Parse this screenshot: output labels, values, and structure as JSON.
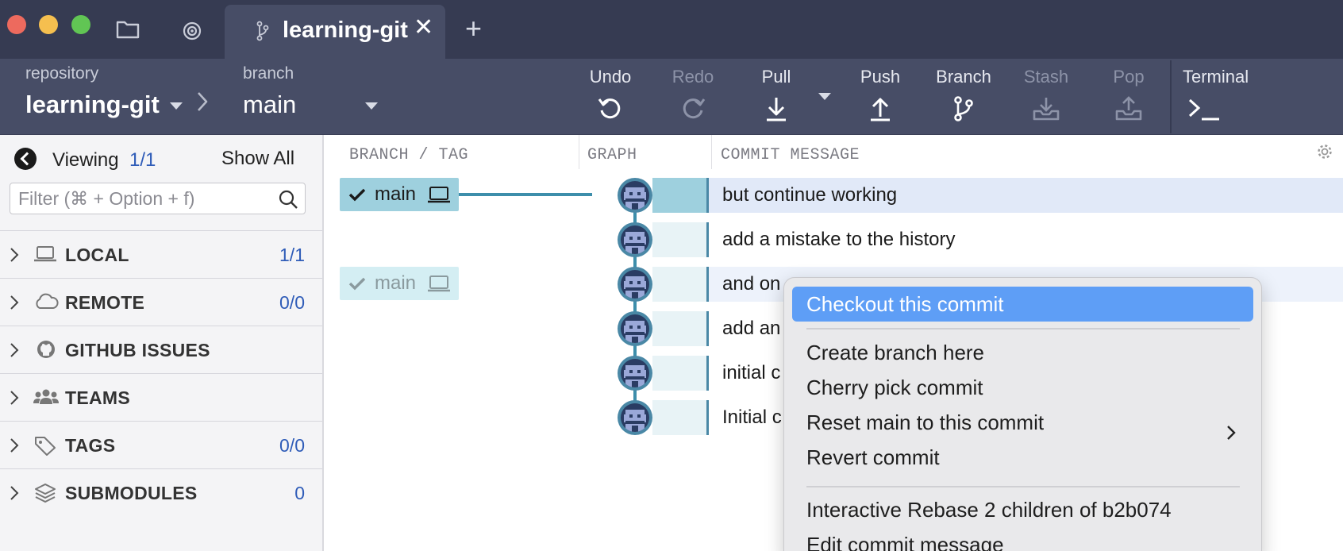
{
  "titlebar": {
    "tab_title": "learning-git",
    "close_glyph": "✕",
    "add_glyph": "+",
    "icons": [
      "folder-icon",
      "radar-icon",
      "branch-icon"
    ]
  },
  "toolbar": {
    "repo_label": "repository",
    "repo_name": "learning-git",
    "branch_label": "branch",
    "branch_name": "main",
    "buttons": {
      "undo": "Undo",
      "redo": "Redo",
      "pull": "Pull",
      "push": "Push",
      "branch": "Branch",
      "stash": "Stash",
      "pop": "Pop",
      "terminal": "Terminal"
    }
  },
  "sidebar": {
    "viewing_label": "Viewing",
    "viewing_count": "1/1",
    "show_all": "Show All",
    "filter_placeholder": "Filter (⌘ + Option + f)",
    "sections": [
      {
        "name": "LOCAL",
        "count": "1/1",
        "icon": "laptop-icon"
      },
      {
        "name": "REMOTE",
        "count": "0/0",
        "icon": "cloud-icon"
      },
      {
        "name": "GITHUB ISSUES",
        "count": "",
        "icon": "github-icon"
      },
      {
        "name": "TEAMS",
        "count": "",
        "icon": "team-icon"
      },
      {
        "name": "TAGS",
        "count": "0/0",
        "icon": "tag-icon"
      },
      {
        "name": "SUBMODULES",
        "count": "0",
        "icon": "layers-icon"
      }
    ]
  },
  "graph": {
    "col_branch": "BRANCH / TAG",
    "col_graph": "GRAPH",
    "col_message": "COMMIT MESSAGE",
    "refs": [
      {
        "name": "main",
        "state": "active"
      },
      {
        "name": "main",
        "state": "faded"
      }
    ],
    "commits": [
      {
        "message": "but continue working",
        "highlighted": true
      },
      {
        "message": "add a mistake to the history",
        "highlighted": false
      },
      {
        "message": "and on",
        "highlighted": true
      },
      {
        "message": "add an",
        "highlighted": false
      },
      {
        "message": "initial c",
        "highlighted": false
      },
      {
        "message": "Initial c",
        "highlighted": false
      }
    ]
  },
  "context_menu": {
    "items": [
      "Checkout this commit",
      "Create branch here",
      "Cherry pick commit",
      "Reset main to this commit",
      "Revert commit",
      "Interactive Rebase 2 children of b2b074",
      "Edit commit message"
    ],
    "highlighted_index": 0
  },
  "colors": {
    "titlebar": "#363b52",
    "toolbar": "#474d66",
    "accent_blue": "#2f5cb8",
    "graph_line": "#3d8eab",
    "menu_highlight": "#5e9ef6"
  }
}
